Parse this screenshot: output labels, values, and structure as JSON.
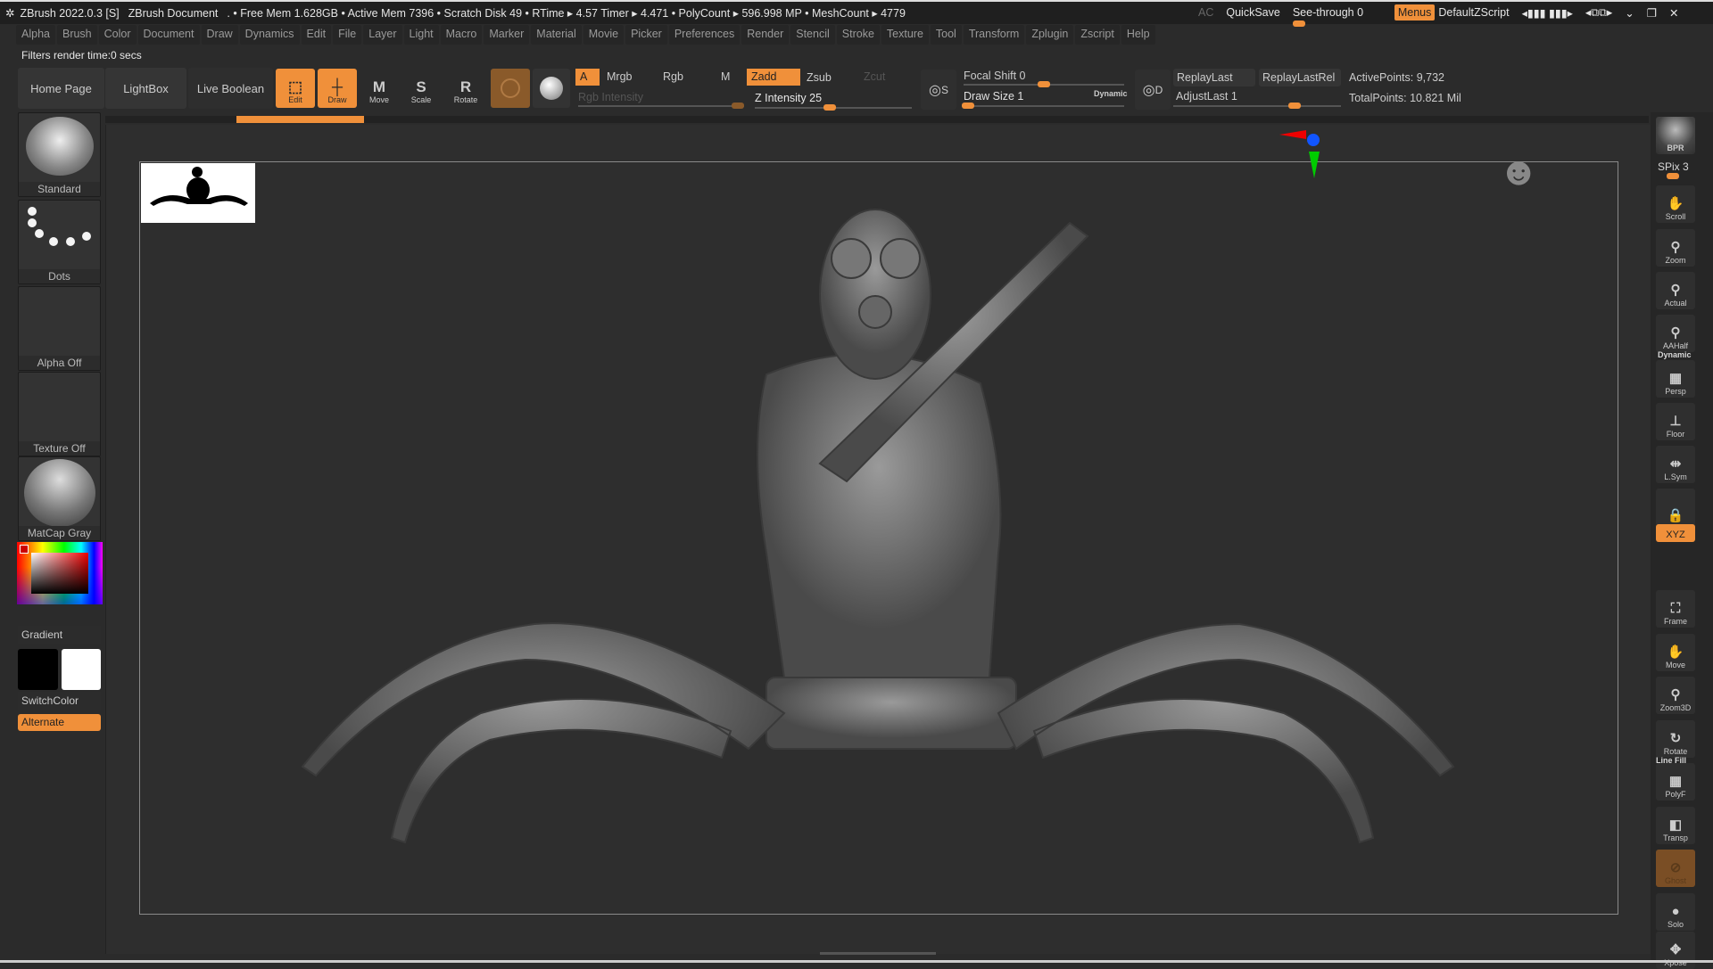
{
  "titlebar": {
    "app": "ZBrush 2022.0.3 [S]",
    "document": "ZBrush Document",
    "stats": ". • Free Mem 1.628GB • Active Mem 7396 • Scratch Disk 49 •  RTime ▸ 4.57 Timer ▸ 4.471 • PolyCount ▸ 596.998 MP  • MeshCount ▸ 4779",
    "ac": "AC",
    "quicksave": "QuickSave",
    "seethrough": "See-through  0",
    "seethrough_value": 0,
    "menus": "Menus",
    "script": "DefaultZScript"
  },
  "menu": [
    "Alpha",
    "Brush",
    "Color",
    "Document",
    "Draw",
    "Dynamics",
    "Edit",
    "File",
    "Layer",
    "Light",
    "Macro",
    "Marker",
    "Material",
    "Movie",
    "Picker",
    "Preferences",
    "Render",
    "Stencil",
    "Stroke",
    "Texture",
    "Tool",
    "Transform",
    "Zplugin",
    "Zscript",
    "Help"
  ],
  "status": "Filters render time:0 secs",
  "toolbar": {
    "home": "Home Page",
    "lightbox": "LightBox",
    "liveboolean": "Live Boolean",
    "edit": "Edit",
    "draw": "Draw",
    "move": "Move",
    "scale": "Scale",
    "rotate": "Rotate",
    "a": "A",
    "mrgb": "Mrgb",
    "rgb": "Rgb",
    "m": "M",
    "zadd": "Zadd",
    "zsub": "Zsub",
    "zcut": "Zcut",
    "rgb_intensity": "Rgb Intensity",
    "z_intensity": "Z Intensity 25",
    "focal_shift": "Focal Shift 0",
    "draw_size": "Draw Size 1",
    "dynamic": "Dynamic",
    "replaylast": "ReplayLast",
    "replaylastrel": "ReplayLastRel",
    "adjustlast": "AdjustLast 1",
    "activepoints": "ActivePoints: 9,732",
    "totalpoints": "TotalPoints: 10.821 Mil",
    "s": "S",
    "d": "D"
  },
  "left": {
    "brush": "Standard",
    "stroke": "Dots",
    "alpha": "Alpha Off",
    "texture": "Texture Off",
    "material": "MatCap Gray",
    "gradient": "Gradient",
    "switchcolor": "SwitchColor",
    "alternate": "Alternate"
  },
  "right": {
    "bpr": "BPR",
    "spix": "SPix 3",
    "items": [
      "Scroll",
      "Zoom",
      "Actual",
      "AAHalf",
      "Persp",
      "Floor",
      "L.Sym",
      "",
      "XYZ",
      "Frame",
      "Move",
      "Zoom3D",
      "Rotate",
      "PolyF",
      "Transp",
      "Ghost",
      "Solo",
      "Xpose"
    ],
    "dynamic": "Dynamic",
    "linefill": "Line Fill"
  },
  "colors": {
    "accent": "#f0903a",
    "bg": "#2b2b2b"
  }
}
